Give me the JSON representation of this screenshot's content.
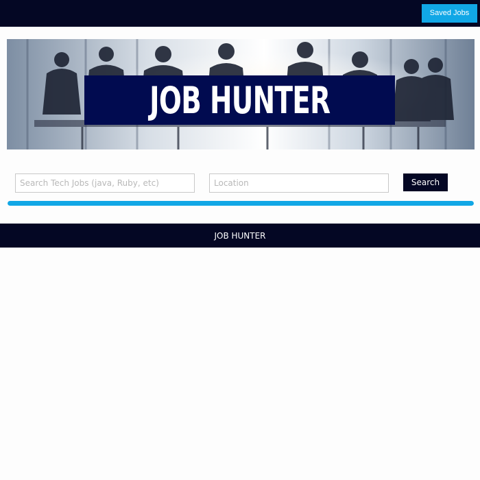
{
  "header": {
    "saved_jobs_label": "Saved Jobs"
  },
  "hero": {
    "title": "JOB HUNTER"
  },
  "search": {
    "keyword_placeholder": "Search Tech Jobs (java, Ruby, etc)",
    "keyword_value": "",
    "location_placeholder": "Location",
    "location_value": "",
    "button_label": "Search"
  },
  "progress": {
    "fraction": 1.0
  },
  "footer": {
    "text": "JOB HUNTER"
  },
  "colors": {
    "navy": "#040724",
    "accent_blue": "#11a7e6",
    "title_box": "#010b50"
  }
}
